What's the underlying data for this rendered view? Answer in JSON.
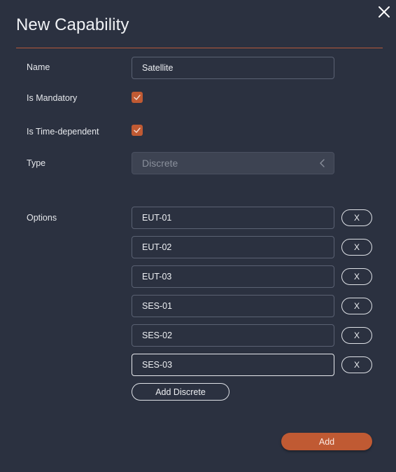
{
  "dialog": {
    "title": "New Capability",
    "close_icon": "close-icon"
  },
  "form": {
    "name_label": "Name",
    "name_value": "Satellite",
    "mandatory_label": "Is Mandatory",
    "mandatory_checked": true,
    "time_dependent_label": "Is Time-dependent",
    "time_dependent_checked": true,
    "type_label": "Type",
    "type_value": "Discrete",
    "options_label": "Options"
  },
  "options": [
    {
      "value": "EUT-01",
      "remove_label": "X"
    },
    {
      "value": "EUT-02",
      "remove_label": "X"
    },
    {
      "value": "EUT-03",
      "remove_label": "X"
    },
    {
      "value": "SES-01",
      "remove_label": "X"
    },
    {
      "value": "SES-02",
      "remove_label": "X"
    },
    {
      "value": "SES-03",
      "remove_label": "X"
    }
  ],
  "buttons": {
    "add_discrete_label": "Add Discrete",
    "add_label": "Add"
  },
  "colors": {
    "background": "#2b3140",
    "accent": "#c05a33",
    "divider": "#b65a3b"
  }
}
